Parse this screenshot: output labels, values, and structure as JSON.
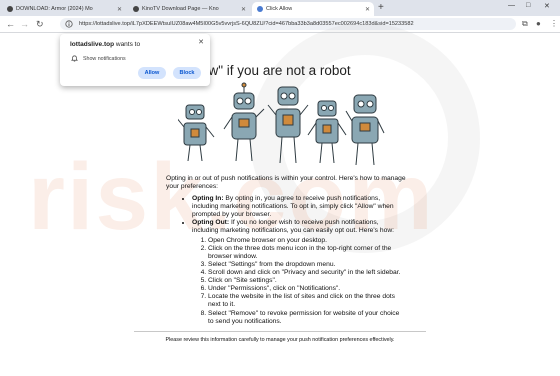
{
  "tabs": [
    {
      "label": "DOWNLOAD: Armor (2024) Mo",
      "favicon_color": "#444444",
      "active": false
    },
    {
      "label": "KinoTV Download Page — Kno",
      "favicon_color": "#444444",
      "active": false
    },
    {
      "label": "Click Allow",
      "favicon_color": "#4a7bd1",
      "active": true
    }
  ],
  "window_controls": {
    "minimize": "—",
    "maximize": "□",
    "close": "✕"
  },
  "toolbar": {
    "url": "https://lottadslive.top/iL7pXDEEWtsuIUZ08aw4M5I00G5v5vvrjsS-6QU8ZU/?cid=467bba33b3a8d03557ec002694c183d&sid=15233582"
  },
  "popup": {
    "site": "lottadslive.top",
    "wants_to": "wants to",
    "request": "Show notifications",
    "allow_label": "Allow",
    "block_label": "Block"
  },
  "page": {
    "headline": "llow\" if you are not a robot",
    "intro": "Opting in or out of push notifications is within your control. Here's how to manage your preferences:",
    "opt_in_title": "Opting In:",
    "opt_in_text": " By opting in, you agree to receive push notifications, including marketing notifications. To opt in, simply click \"Allow\" when prompted by your browser.",
    "opt_out_title": "Opting Out:",
    "opt_out_text": " If you no longer wish to receive push notifications, including marketing notifications, you can easily opt out. Here's how:",
    "steps": [
      "Open Chrome browser on your desktop.",
      "Click on the three dots menu icon in the top-right corner of the browser window.",
      "Select \"Settings\" from the dropdown menu.",
      "Scroll down and click on \"Privacy and security\" in the left sidebar.",
      "Click on \"Site settings\".",
      "Under \"Permissions\", click on \"Notifications\".",
      "Locate the website in the list of sites and click on the three dots next to it.",
      "Select \"Remove\" to revoke permission for website of your choice to send you notifications."
    ],
    "footer": "Please review this information carefully to manage your push notification preferences effectively."
  },
  "watermark": "risk.com",
  "colors": {
    "tabbar": "#dfe3eb",
    "robot_body": "#8aa7b3",
    "robot_accent": "#d08a3c",
    "button_bg": "#d3e3fd",
    "button_text": "#0b57d0"
  }
}
